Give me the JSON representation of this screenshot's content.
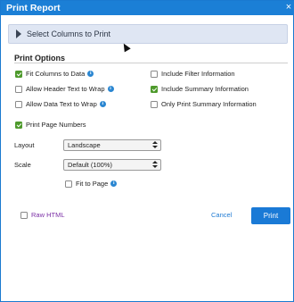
{
  "dialog": {
    "title": "Print Report",
    "close_glyph": "×"
  },
  "columns_section": {
    "label": "Select Columns to Print",
    "icon": "chevron-right-icon"
  },
  "print_options": {
    "title": "Print Options",
    "fit_columns": {
      "label": "Fit Columns to Data",
      "checked": true,
      "info": "i"
    },
    "allow_header_wrap": {
      "label": "Allow Header Text to Wrap",
      "checked": false,
      "info": "i"
    },
    "allow_data_wrap": {
      "label": "Allow Data Text to Wrap",
      "checked": false,
      "info": "i"
    },
    "print_page_numbers": {
      "label": "Print Page Numbers",
      "checked": true
    },
    "include_filter": {
      "label": "Include Filter Information",
      "checked": false
    },
    "include_summary": {
      "label": "Include Summary Information",
      "checked": true
    },
    "only_summary": {
      "label": "Only Print Summary Information",
      "checked": false
    }
  },
  "layout": {
    "label": "Layout",
    "value": "Landscape"
  },
  "scale": {
    "label": "Scale",
    "value": "Default (100%)"
  },
  "fit_to_page": {
    "label": "Fit to Page",
    "checked": false,
    "info": "i"
  },
  "raw_html": {
    "label": "Raw HTML",
    "checked": false
  },
  "buttons": {
    "cancel": "Cancel",
    "print": "Print"
  },
  "colors": {
    "accent": "#1b7fd6",
    "check": "#4e9a2c",
    "raw_html": "#7b2fa6"
  }
}
